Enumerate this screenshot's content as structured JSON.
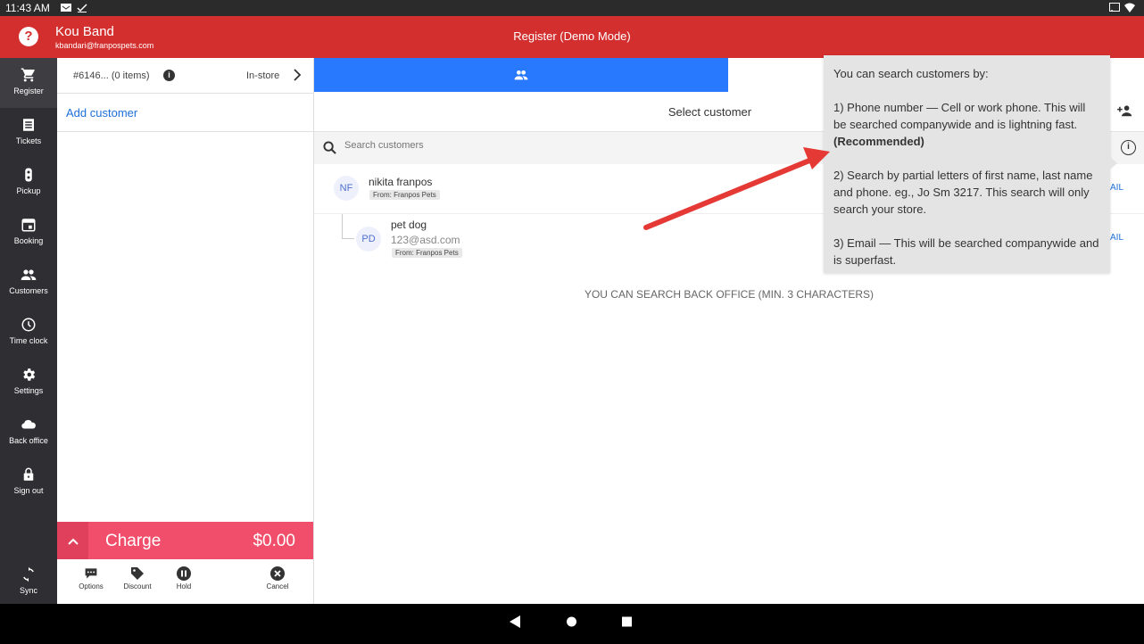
{
  "status_bar": {
    "time": "11:43 AM"
  },
  "header": {
    "help_label": "?",
    "user_name": "Kou Band",
    "user_email": "kbandari@franpospets.com",
    "title": "Register  (Demo Mode)"
  },
  "sidebar": {
    "items": [
      {
        "label": "Register",
        "icon": "cart-icon"
      },
      {
        "label": "Tickets",
        "icon": "tickets-icon"
      },
      {
        "label": "Pickup",
        "icon": "pickup-icon"
      },
      {
        "label": "Booking",
        "icon": "calendar-icon"
      },
      {
        "label": "Customers",
        "icon": "people-icon"
      },
      {
        "label": "Time clock",
        "icon": "clock-icon"
      },
      {
        "label": "Settings",
        "icon": "gear-icon"
      },
      {
        "label": "Back office",
        "icon": "cloud-icon"
      },
      {
        "label": "Sign out",
        "icon": "lock-icon"
      }
    ],
    "sync_label": "Sync"
  },
  "order": {
    "id_label": "#6146... (0 items)",
    "info": "i",
    "mode": "In-store",
    "add_customer": "Add customer"
  },
  "charge": {
    "label": "Charge",
    "amount": "$0.00"
  },
  "actions": {
    "options": "Options",
    "discount": "Discount",
    "hold": "Hold",
    "cancel": "Cancel"
  },
  "main": {
    "select_title": "Select customer",
    "search_placeholder": "Search customers",
    "info": "i",
    "customers": [
      {
        "initials": "NF",
        "name": "nikita franpos",
        "tag": "From: Franpos Pets",
        "detail": "AIL"
      },
      {
        "initials": "PD",
        "name": "pet dog",
        "email": "123@asd.com",
        "tag": "From: Franpos Pets",
        "detail": "AIL"
      }
    ],
    "back_office_msg": "YOU CAN SEARCH BACK OFFICE (MIN. 3 CHARACTERS)"
  },
  "tooltip": {
    "heading": "You can search customers by:",
    "item1": "1) Phone number — Cell or work phone. This will be searched companywide and is lightning fast.",
    "item1_bold": "(Recommended)",
    "item2": "2) Search by partial letters of first name, last name and phone. eg., Jo Sm 3217. This search will only search your store.",
    "item3": "3) Email — This will be searched companywide and is superfast."
  },
  "colors": {
    "header": "#d32f2f",
    "sidebar": "#2f2f33",
    "tab_active": "#2979ff",
    "charge": "#f04e6a",
    "link": "#1e6fd9",
    "arrow": "#e53935"
  }
}
